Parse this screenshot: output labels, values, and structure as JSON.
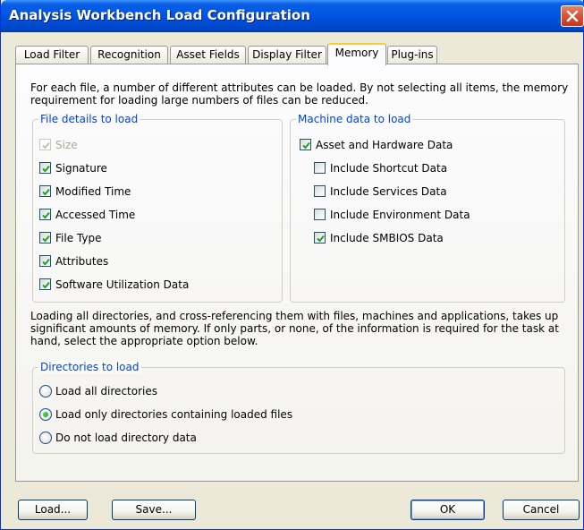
{
  "window": {
    "title": "Analysis Workbench Load Configuration"
  },
  "tabs": [
    {
      "label": "Load Filter",
      "active": false
    },
    {
      "label": "Recognition",
      "active": false
    },
    {
      "label": "Asset Fields",
      "active": false
    },
    {
      "label": "Display Filter",
      "active": false
    },
    {
      "label": "Memory",
      "active": true
    },
    {
      "label": "Plug-ins",
      "active": false
    }
  ],
  "memory": {
    "intro_line1": "For each file, a number of different attributes can be loaded.  By not selecting all items, the memory",
    "intro_line2": "requirement for loading large numbers of files can be reduced.",
    "file_details": {
      "legend": "File details to load",
      "items": [
        {
          "label": "Size",
          "checked": true,
          "disabled": true
        },
        {
          "label": "Signature",
          "checked": true,
          "disabled": false
        },
        {
          "label": "Modified Time",
          "checked": true,
          "disabled": false
        },
        {
          "label": "Accessed Time",
          "checked": true,
          "disabled": false
        },
        {
          "label": "File Type",
          "checked": true,
          "disabled": false
        },
        {
          "label": "Attributes",
          "checked": true,
          "disabled": false
        },
        {
          "label": "Software Utilization Data",
          "checked": true,
          "disabled": false
        }
      ]
    },
    "machine_data": {
      "legend": "Machine data to load",
      "items": [
        {
          "label": "Asset and Hardware Data",
          "checked": true
        },
        {
          "label": "Include Shortcut Data",
          "checked": false
        },
        {
          "label": "Include Services Data",
          "checked": false
        },
        {
          "label": "Include Environment Data",
          "checked": false
        },
        {
          "label": "Include SMBIOS Data",
          "checked": true
        }
      ]
    },
    "directories_text": {
      "line1": "Loading all directories, and cross-referencing them with files, machines and applications, takes up",
      "line2": "significant amounts of memory.  If only parts, or none, of the information is required for the task at",
      "line3": "hand, select the appropriate option below."
    },
    "directories": {
      "legend": "Directories to load",
      "options": [
        {
          "label": "Load all directories",
          "selected": false
        },
        {
          "label": "Load only directories containing loaded files",
          "selected": true
        },
        {
          "label": "Do not load directory data",
          "selected": false
        }
      ]
    }
  },
  "buttons": {
    "load": "Load...",
    "save": "Save...",
    "ok": "OK",
    "cancel": "Cancel"
  },
  "colors": {
    "titlebar": "#0054e3",
    "group_legend": "#0046d5",
    "active_tab_highlight": "#ffc83c",
    "close_button": "#d8563a",
    "checkmark": "#21a121"
  }
}
